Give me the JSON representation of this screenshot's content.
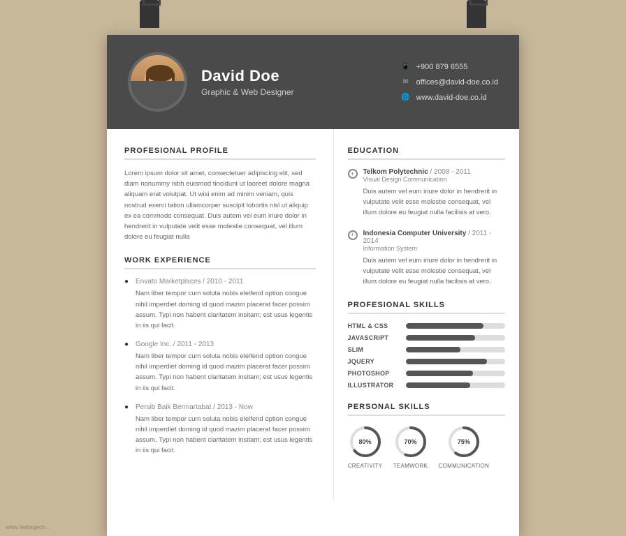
{
  "page": {
    "background_color": "#c8b89a"
  },
  "header": {
    "name": "David Doe",
    "title": "Graphic & Web Designer",
    "phone_icon": "📱",
    "phone": "+900 879 6555",
    "email_icon": "✉",
    "email": "offices@david-doe.co.id",
    "website_icon": "🌐",
    "website": "www.david-doe.co.id"
  },
  "profile": {
    "section_title": "PROFESIONAL PROFILE",
    "text": "Lorem ipsum dolor sit amet, consectetuer adipiscing elit, sed diam nonummy nibh euismod tincidunt ut laoreet dolore magna aliquam erat volutpat. Ut wisi enim ad minim veniam, quis nostrud exerci tation ullamcorper suscipit lobortis nisl ut aliquip ex ea commodo consequat. Duis autem vel eum iriure dolor in hendrerit in vulputate velit esse molestie consequat, vel illum dolore eu feugiat nulla"
  },
  "work_experience": {
    "section_title": "WORK EXPERIENCE",
    "items": [
      {
        "company": "Envato Marketplaces /",
        "period": "2010 - 2011",
        "description": "Nam liber tempor cum soluta nobis eleifend option congue nihil imperdiet doming id quod mazim placerat facer possim assum. Typi non habent claritatem insitam; est usus legentis in iis qui facit."
      },
      {
        "company": "Google Inc. /",
        "period": "2011 - 2013",
        "description": "Nam liber tempor cum soluta nobis eleifend option congue nihil imperdiet doming id quod mazim placerat facer possim assum. Typi non habent claritatem insitam; est usus legentis in iis qui facit."
      },
      {
        "company": "Persib Baik Bermartabat /",
        "period": "2013 - Now",
        "description": "Nam liber tempor cum soluta nobis eleifend option congue nihil imperdiet doming id quod mazim placerat facer possim assum. Typi non habent claritatem insitam; est usus legentis in iis qui facit."
      }
    ]
  },
  "education": {
    "section_title": "EDUCATION",
    "items": [
      {
        "school": "Telkom Polytechnic /",
        "period": "2008 - 2011",
        "degree": "Visual Design Communication",
        "description": "Duis autem vel eum iriure dolor in hendrerit in vulputate velit esse molestie consequat, vel illum dolore eu feugiat nulla facilisis at vero."
      },
      {
        "school": "Indonesia Computer University /",
        "period": "2011 - 2014",
        "degree": "Information System",
        "description": "Duis autem vel eum iriure dolor in hendrerit in vulputate velit esse molestie consequat, vel illum dolore eu feugiat nulla facilisis at vero."
      }
    ]
  },
  "skills": {
    "section_title": "PROFESIONAL SKILLS",
    "items": [
      {
        "label": "HTML & CSS",
        "percent": 78
      },
      {
        "label": "JAVASCRIPT",
        "percent": 70
      },
      {
        "label": "SLIM",
        "percent": 55
      },
      {
        "label": "JQUERY",
        "percent": 82
      },
      {
        "label": "PHOTOSHOP",
        "percent": 68
      },
      {
        "label": "ILLUSTRATOR",
        "percent": 65
      }
    ]
  },
  "personal_skills": {
    "section_title": "PERSONAL SKILLS",
    "items": [
      {
        "label": "CREATIVITY",
        "percent": 80
      },
      {
        "label": "TEAMWORK",
        "percent": 70
      },
      {
        "label": "COMMUNICATION",
        "percent": 75
      }
    ]
  },
  "watermark": "www.heritagech..."
}
